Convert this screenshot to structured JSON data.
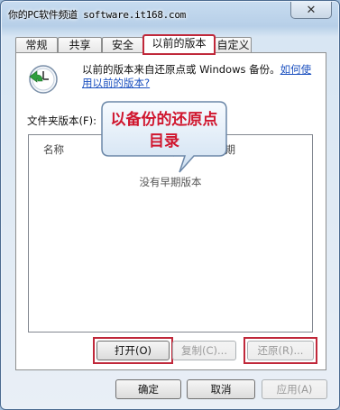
{
  "window": {
    "title": "你的PC软件频道 software.it168.com",
    "close_glyph": "✕"
  },
  "tabs": [
    {
      "label": "常规",
      "active": false
    },
    {
      "label": "共享",
      "active": false
    },
    {
      "label": "安全",
      "active": false
    },
    {
      "label": "以前的版本",
      "active": true
    },
    {
      "label": "自定义",
      "active": false
    }
  ],
  "panel": {
    "icon": "restore-clock-icon",
    "description": "以前的版本来自还原点或 Windows 备份。",
    "help_link": "如何使用以前的版本?",
    "list_label": "文件夹版本(F):",
    "columns": [
      "名称",
      "修改日期"
    ],
    "empty_text": "没有早期版本",
    "callout": "以备份的还原点目录"
  },
  "actions": {
    "open": "打开(O)",
    "copy": "复制(C)...",
    "restore": "还原(R)..."
  },
  "dialog_buttons": {
    "ok": "确定",
    "cancel": "取消",
    "apply": "应用(A)"
  },
  "colors": {
    "highlight": "#c0283a",
    "callout_text": "#d0162e",
    "link": "#1a4fbf"
  }
}
